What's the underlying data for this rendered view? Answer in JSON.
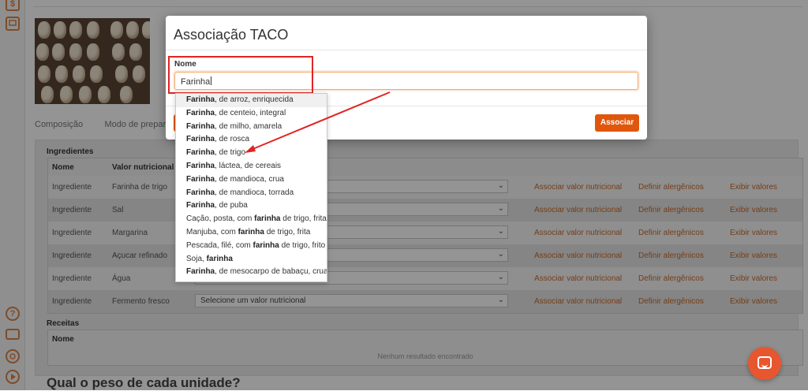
{
  "rail": {
    "icons": [
      "dollar-icon",
      "recipe-icon",
      "help-icon",
      "billing-icon",
      "settings-icon",
      "play-icon"
    ],
    "dollar_glyph": "$",
    "help_glyph": "?"
  },
  "tabs": [
    {
      "label": "Composição"
    },
    {
      "label": "Modo de preparo"
    }
  ],
  "ingredients": {
    "title": "Ingredientes",
    "col_name": "Nome",
    "col_value": "Valor nutricional",
    "rows": [
      {
        "type": "Ingrediente",
        "name": "Farinha de trigo",
        "select": ""
      },
      {
        "type": "Ingrediente",
        "name": "Sal",
        "select": ""
      },
      {
        "type": "Ingrediente",
        "name": "Margarina",
        "select": ""
      },
      {
        "type": "Ingrediente",
        "name": "Açucar refinado",
        "select": ""
      },
      {
        "type": "Ingrediente",
        "name": "Água",
        "select": ""
      },
      {
        "type": "Ingrediente",
        "name": "Fermento fresco",
        "select": "Selecione um valor nutricional"
      }
    ],
    "actions": {
      "associate": "Associar valor nutricional",
      "allergens": "Definir alergênicos",
      "show": "Exibir valores"
    }
  },
  "recipes": {
    "title": "Receitas",
    "col_name": "Nome",
    "empty": "Nenhum resultado encontrado"
  },
  "weight_question": "Qual o peso de cada unidade?",
  "modal": {
    "title": "Associação TACO",
    "field_label": "Nome",
    "field_value": "Farinha",
    "associate_button": "Associar",
    "suggestions": [
      {
        "bold": "Farinha",
        "pre": "",
        "rest": ", de arroz, enriquecida"
      },
      {
        "bold": "Farinha",
        "pre": "",
        "rest": ", de centeio, integral"
      },
      {
        "bold": "Farinha",
        "pre": "",
        "rest": ", de milho, amarela"
      },
      {
        "bold": "Farinha",
        "pre": "",
        "rest": ", de rosca"
      },
      {
        "bold": "Farinha",
        "pre": "",
        "rest": ", de trigo"
      },
      {
        "bold": "Farinha",
        "pre": "",
        "rest": ", láctea, de cereais"
      },
      {
        "bold": "Farinha",
        "pre": "",
        "rest": ", de mandioca, crua"
      },
      {
        "bold": "Farinha",
        "pre": "",
        "rest": ", de mandioca, torrada"
      },
      {
        "bold": "Farinha",
        "pre": "",
        "rest": ", de puba"
      },
      {
        "bold": "farinha",
        "pre": "Cação, posta, com ",
        "rest": " de trigo, frita"
      },
      {
        "bold": "farinha",
        "pre": "Manjuba, com ",
        "rest": " de trigo, frita"
      },
      {
        "bold": "farinha",
        "pre": "Pescada, filé, com ",
        "rest": " de trigo, frito"
      },
      {
        "bold": "farinha",
        "pre": "Soja, ",
        "rest": ""
      },
      {
        "bold": "Farinha",
        "pre": "",
        "rest": ", de mesocarpo de babaçu, crua"
      }
    ]
  },
  "colors": {
    "accent": "#e0570c",
    "annotation": "#e02424"
  }
}
